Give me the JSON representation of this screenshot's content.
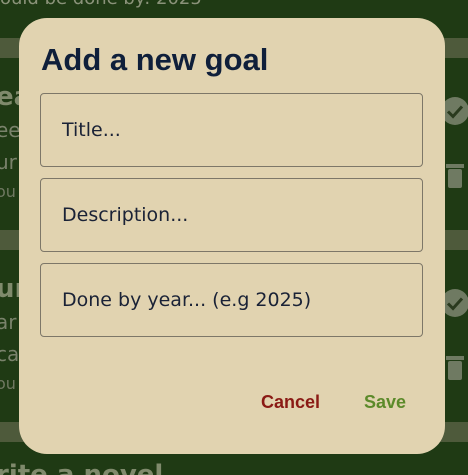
{
  "dialog": {
    "title": "Add a new goal",
    "fields": {
      "title": {
        "placeholder": "Title...",
        "value": ""
      },
      "description": {
        "placeholder": "Description...",
        "value": ""
      },
      "done_by": {
        "placeholder": "Done by year... (e.g 2025)",
        "value": ""
      }
    },
    "actions": {
      "cancel_label": "Cancel",
      "save_label": "Save"
    }
  },
  "background": {
    "top_fragment": "ould be done by: 2025",
    "cards": [
      {
        "title_fragment": "ea",
        "line_fragment": "ee",
        "line2_fragment": "ur",
        "small_fragment": "ou"
      },
      {
        "title_fragment": "ur",
        "line_fragment": "ar",
        "line2_fragment": "ca",
        "small_fragment": "ou"
      }
    ],
    "bottom_fragment": "rite a novel",
    "icons": [
      "check-circle-icon",
      "trash-icon",
      "check-circle-icon",
      "trash-icon"
    ]
  },
  "colors": {
    "app_background": "#1f3a14",
    "dialog_background": "#e1d3b0",
    "title_text": "#0f1f3a",
    "cancel": "#8a1a14",
    "save": "#5c8a2a"
  }
}
